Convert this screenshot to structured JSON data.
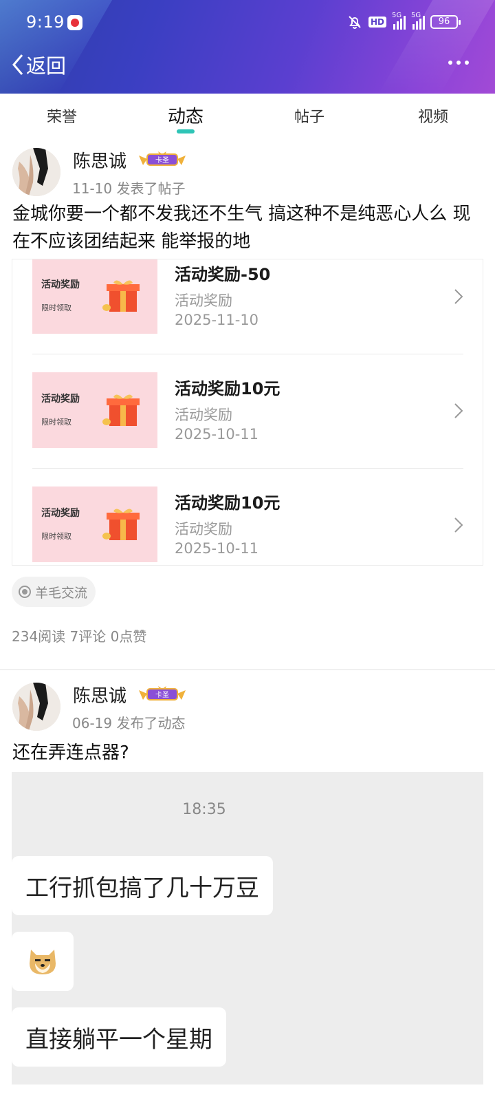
{
  "status_bar": {
    "time": "9:19",
    "hd": "HD",
    "battery": "96",
    "signal1": "5G",
    "signal2": "5G"
  },
  "nav": {
    "back_label": "返回"
  },
  "tabs": [
    {
      "label": "荣誉"
    },
    {
      "label": "动态"
    },
    {
      "label": "帖子"
    },
    {
      "label": "视频"
    }
  ],
  "posts": [
    {
      "author": "陈思诚",
      "badge": "卡圣",
      "meta": "11-10  发表了帖子",
      "text": "金城你要一个都不发我还不生气 搞这种不是纯恶心人么 现在不应该团结起来 能举报的地",
      "rewards": [
        {
          "thumb_title": "活动奖励",
          "thumb_sub": "限时领取",
          "title": "活动奖励-50",
          "subtitle": "活动奖励",
          "date": "2025-11-10"
        },
        {
          "thumb_title": "活动奖励",
          "thumb_sub": "限时领取",
          "title": "活动奖励10元",
          "subtitle": "活动奖励",
          "date": "2025-10-11"
        },
        {
          "thumb_title": "活动奖励",
          "thumb_sub": "限时领取",
          "title": "活动奖励10元",
          "subtitle": "活动奖励",
          "date": "2025-10-11"
        }
      ],
      "topic": "羊毛交流",
      "stats": "234阅读  7评论  0点赞"
    },
    {
      "author": "陈思诚",
      "badge": "卡圣",
      "meta": "06-19  发布了动态",
      "text": "还在弄连点器?",
      "chat": {
        "time": "18:35",
        "messages": [
          "工行抓包搞了几十万豆",
          "直接躺平一个星期"
        ]
      }
    }
  ],
  "colors": {
    "accent": "#2ec4b6",
    "header_start": "#2e3fa8",
    "header_end": "#a24ad6"
  }
}
